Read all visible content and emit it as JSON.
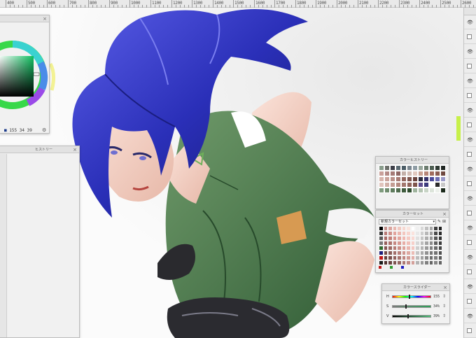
{
  "ruler": {
    "labels": [
      "400",
      "500",
      "600",
      "700",
      "800",
      "900",
      "1000",
      "1100",
      "1200",
      "1300",
      "1400",
      "1500",
      "1600",
      "1700",
      "1800",
      "1900",
      "2000",
      "2100",
      "2200",
      "2300",
      "2400",
      "2500",
      "2600"
    ]
  },
  "color_wheel": {
    "title": "",
    "values": {
      "h": "155",
      "s": "34",
      "v": "39"
    },
    "current_color": "#2f5a3c"
  },
  "history_panel": {
    "title": "ヒストリー"
  },
  "color_history": {
    "title": "カラーヒストリー",
    "swatches": [
      "#8a9d8c",
      "#6c6f6a",
      "#3d3f48",
      "#5b6a72",
      "#4b5c66",
      "#7b8790",
      "#8e9ca4",
      "#9aa89e",
      "#6b7b6e",
      "#4e5e52",
      "#2f3a33",
      "#1f2622",
      "#c9a09a",
      "#b48a86",
      "#a57a76",
      "#8f6663",
      "#c4b0a8",
      "#d3bdb4",
      "#e2c9bf",
      "#c8a294",
      "#b68678",
      "#a06c5e",
      "#8a5b50",
      "#6f4940",
      "#d7b5ad",
      "#caa39b",
      "#ba9089",
      "#a77b74",
      "#93675f",
      "#7f554d",
      "#6b443d",
      "#2b2c3e",
      "#34316a",
      "#4a4a9a",
      "#6a6ab0",
      "#9a9ac8",
      "#e0c4bc",
      "#d1b0a7",
      "#c49d93",
      "#b48a80",
      "#a3786e",
      "#91665c",
      "#7f554b",
      "#5f4f8f",
      "#3c3b7c",
      "#ffffff",
      "#2a2a2a",
      "#c8c8c8",
      "#7f9b7e",
      "#6f8c6e",
      "#5f7c5e",
      "#4f6c4e",
      "#3f5c3e",
      "#2f4c2e",
      "#a0b49e",
      "#b4c4b2",
      "#c8d4c6",
      "#dce4da",
      "#ecf0ea",
      "#1c2a1c"
    ]
  },
  "color_set": {
    "title": "カラーセット",
    "set_name": "新規カラーセット",
    "swatches": [
      "#000000",
      "#c38f8a",
      "#d9a49e",
      "#e8b8b0",
      "#f1c9c1",
      "#f6d7d0",
      "#fae4de",
      "#ffffff",
      "#f0f0f0",
      "#d8d8d8",
      "#c0c0c0",
      "#a8a8a8",
      "#404040",
      "#202020",
      "#3a3a3a",
      "#b97b77",
      "#cf908a",
      "#e2a39c",
      "#ecb6ae",
      "#f3c6be",
      "#f8d4cd",
      "#fbe2dc",
      "#e8e8e8",
      "#cfcfcf",
      "#b7b7b7",
      "#9f9f9f",
      "#4a4a4a",
      "#2a2a2a",
      "#5a5a5a",
      "#a86a66",
      "#c17f79",
      "#d6938c",
      "#e4a59e",
      "#eeb8b1",
      "#f5c9c2",
      "#f9d8d2",
      "#e0e0e0",
      "#c6c6c6",
      "#adadad",
      "#959595",
      "#555555",
      "#333333",
      "#787878",
      "#96605c",
      "#ae736e",
      "#c68781",
      "#d99a93",
      "#e7ada6",
      "#f1bfb8",
      "#f7cfc9",
      "#d7d7d7",
      "#bdbdbd",
      "#a3a3a3",
      "#8b8b8b",
      "#606060",
      "#3c3c3c",
      "#2e6b2e",
      "#845652",
      "#9c6863",
      "#b47b75",
      "#cb8e88",
      "#dca29b",
      "#eab5ae",
      "#f3c6c0",
      "#cecece",
      "#b4b4b4",
      "#9a9a9a",
      "#818181",
      "#6a6a6a",
      "#464646",
      "#1d1d7a",
      "#734b48",
      "#8a5d59",
      "#a26f6b",
      "#ba827d",
      "#ce958f",
      "#dfa9a2",
      "#ecbcb5",
      "#c5c5c5",
      "#ababab",
      "#919191",
      "#777777",
      "#737373",
      "#505050",
      "#c01818",
      "#623f3c",
      "#794f4c",
      "#90615d",
      "#a7736f",
      "#bd8681",
      "#d19a94",
      "#e1aea8",
      "#bcbcbc",
      "#a2a2a2",
      "#888888",
      "#6e6e6e",
      "#7d7d7d",
      "#5a5a5a",
      "#1a1a1a",
      "#523431",
      "#684340",
      "#7e5450",
      "#956662",
      "#ab7974",
      "#c08c87",
      "#d4a09a",
      "#b3b3b3",
      "#999999",
      "#7f7f7f",
      "#656565",
      "#868686",
      "#646464"
    ],
    "footer_colors": [
      "#c01818",
      "#2e9b2e",
      "#1d1dc0"
    ]
  },
  "color_slider": {
    "title": "カラースライダー",
    "rows": [
      {
        "key": "H",
        "value": "155",
        "fraction": 0.43
      },
      {
        "key": "S",
        "value": "34%",
        "fraction": 0.34
      },
      {
        "key": "V",
        "value": "39%",
        "fraction": 0.39
      }
    ]
  },
  "layers": {
    "row_count": 22
  }
}
